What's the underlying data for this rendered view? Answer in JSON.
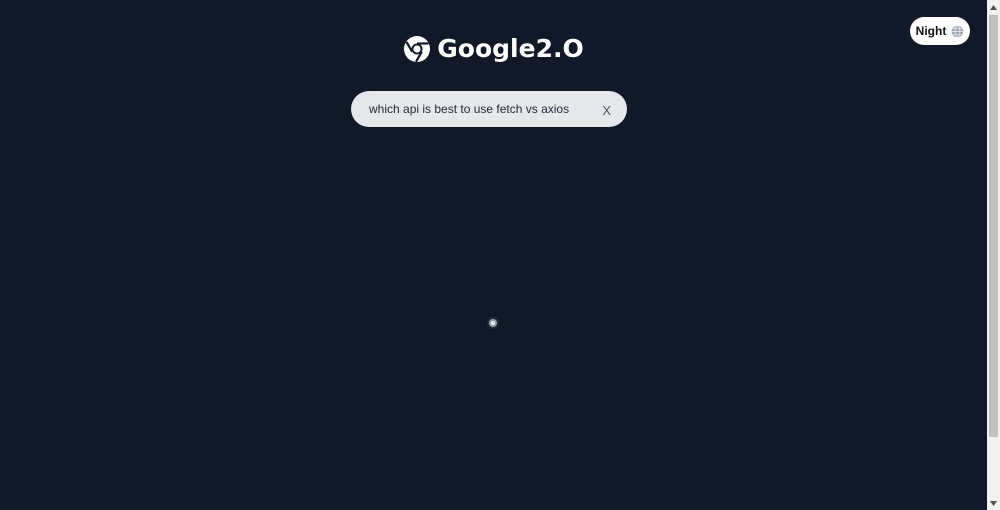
{
  "header": {
    "logo_text": "Google2.O",
    "logo_icon": "chrome-icon"
  },
  "theme_toggle": {
    "label": "Night",
    "icon": "globe-icon"
  },
  "search": {
    "value": "which api is best to use fetch vs axios",
    "clear_label": "X"
  },
  "status": {
    "loading_indicator": "spinner"
  },
  "colors": {
    "background": "#111827",
    "search_bg": "#e5e7eb",
    "toggle_bg": "#ffffff",
    "text_light": "#ffffff"
  }
}
